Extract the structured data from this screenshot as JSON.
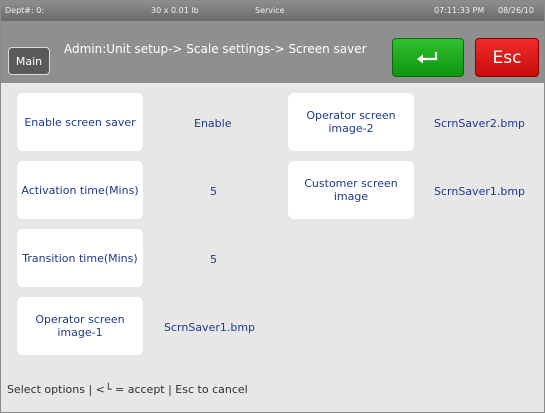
{
  "statusbar": {
    "dept": "Dept#: 0:",
    "weight": "30 x 0.01 lb",
    "mode": "Service",
    "time": "07:11:33 PM",
    "date": "08/26/10"
  },
  "header": {
    "main_label": "Main",
    "breadcrumb": "Admin:Unit setup-> Scale settings-> Screen saver",
    "enter_icon": "enter-arrow-icon",
    "esc_label": "Esc",
    "colors": {
      "enter": "#1faa1f",
      "esc": "#e01818",
      "header_bg": "#8f8f8f"
    }
  },
  "options": {
    "enable_screen_saver": {
      "label": "Enable screen saver",
      "value": "Enable"
    },
    "activation_time": {
      "label": "Activation time(Mins)",
      "value": "5"
    },
    "transition_time": {
      "label": "Transition time(Mins)",
      "value": "5"
    },
    "operator_image_1": {
      "label": "Operator screen image-1",
      "value": "ScrnSaver1.bmp"
    },
    "operator_image_2": {
      "label": "Operator screen image-2",
      "value": "ScrnSaver2.bmp"
    },
    "customer_image": {
      "label": "Customer screen image",
      "value": "ScrnSaver1.bmp"
    }
  },
  "footer": {
    "prefix": "Select options | <",
    "suffix": " = accept | Esc to cancel"
  }
}
